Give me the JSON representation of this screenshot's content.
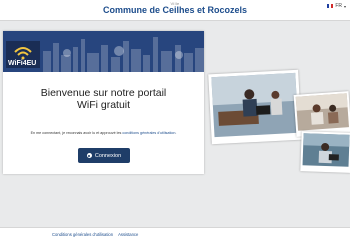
{
  "header": {
    "kicker": "Ville",
    "town_name": "Commune de Ceilhes et Rocozels",
    "language": "FR",
    "flag_colors": [
      "#1f3fa0",
      "#ffffff",
      "#d22b2b"
    ]
  },
  "banner": {
    "logo_text": "WiFi4EU",
    "colors": {
      "sky": "#27457e",
      "logo_bg": "#1a2d55",
      "wifi": "#f3c640"
    }
  },
  "main": {
    "welcome_line1": "Bienvenue sur notre portail",
    "welcome_line2": "WiFi gratuit",
    "consent_prefix": "En me connectant, je reconnais avoir lu et approuvé les",
    "consent_link": "conditions générales d'utilisation",
    "consent_suffix": ".",
    "connect_label": "Connexion",
    "button_color": "#1f3d68"
  },
  "footer": {
    "links": [
      "Conditions générales d'utilisation",
      "Assistance"
    ]
  },
  "photos": [
    "people-using-wifi-photo-1",
    "people-using-wifi-photo-2",
    "people-using-wifi-photo-3"
  ]
}
